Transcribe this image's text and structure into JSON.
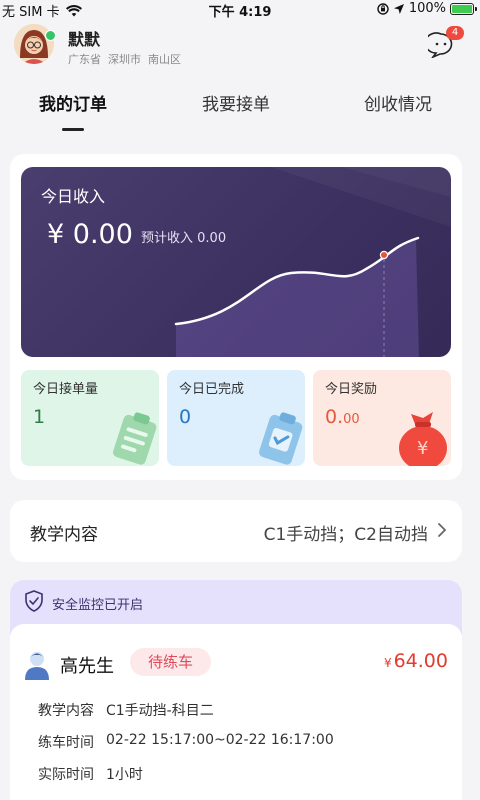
{
  "status_bar": {
    "carrier": "无 SIM 卡",
    "time": "下午 4:19",
    "battery": "100%",
    "icons": [
      "wifi-icon",
      "orientation-lock-icon",
      "location-arrow-icon",
      "battery-charging-icon"
    ]
  },
  "user": {
    "name": "默默",
    "province": "广东省",
    "city": "深圳市",
    "district": "南山区",
    "message_count": "4"
  },
  "tabs": [
    {
      "label": "我的订单",
      "active": true
    },
    {
      "label": "我要接单",
      "active": false
    },
    {
      "label": "创收情况",
      "active": false
    }
  ],
  "income": {
    "title": "今日收入",
    "value": "¥ 0.00",
    "estimate_label": "预计收入",
    "estimate_value": "0.00"
  },
  "stats": [
    {
      "label": "今日接单量",
      "value": "1",
      "icon": "clipboard-list-icon"
    },
    {
      "label": "今日已完成",
      "value": "0",
      "icon": "clipboard-check-icon"
    },
    {
      "label": "今日奖励",
      "value_main": "0.",
      "value_small": "00",
      "icon": "money-bag-icon"
    }
  ],
  "teaching": {
    "label": "教学内容",
    "value": "C1手动挡；C2自动挡"
  },
  "safety": {
    "text": "安全监控已开启"
  },
  "order": {
    "name": "高先生",
    "status": "待练车",
    "currency": "¥",
    "price": "64.00",
    "rows": [
      {
        "label": "教学内容",
        "value": "C1手动挡-科目二"
      },
      {
        "label": "练车时间",
        "value": "02-22 15:17:00~02-22 16:17:00"
      },
      {
        "label": "实际时间",
        "value": "1小时"
      }
    ]
  },
  "colors": {
    "income_panel": "#3c3060",
    "stat_green": "#dff5e8",
    "stat_blue": "#ddeefc",
    "stat_red": "#fde8e2",
    "price_red": "#e33b2e",
    "badge_red": "#f04a3e",
    "safety_bg": "#e5e0fb"
  }
}
